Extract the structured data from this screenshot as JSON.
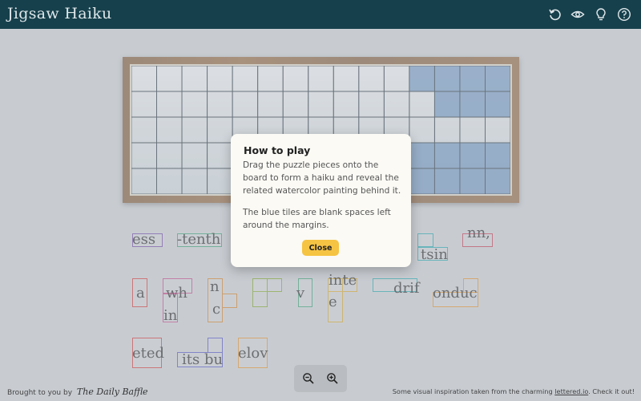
{
  "header": {
    "title": "Jigsaw Haiku",
    "icons": [
      "restart-icon",
      "eye-icon",
      "hint-bulb-icon",
      "help-icon"
    ]
  },
  "pieces": [
    {
      "text": "ess",
      "color": "#6b3fa0"
    },
    {
      "text": "-tenth",
      "color": "#2e9a6b"
    },
    {
      "text": "tsin",
      "color": "#1aa0a8"
    },
    {
      "text": "nn,",
      "color": "#c0344a"
    },
    {
      "text": "a",
      "color": "#d03030"
    },
    {
      "text": "wh",
      "color": "#c04080"
    },
    {
      "text": "in",
      "color": "#c04080"
    },
    {
      "text": "n",
      "color": "#d07a20"
    },
    {
      "text": "c",
      "color": "#d07a20"
    },
    {
      "text": "v",
      "color": "#2e9a6b"
    },
    {
      "text": "inte",
      "color": "#d4a020"
    },
    {
      "text": "e",
      "color": "#d4a020"
    },
    {
      "text": "drif",
      "color": "#1aa0a8"
    },
    {
      "text": "onduc",
      "color": "#e08a20"
    },
    {
      "text": "eted",
      "color": "#d03030"
    },
    {
      "text": "its bu",
      "color": "#4a4ac0"
    },
    {
      "text": "elov",
      "color": "#e08a20"
    }
  ],
  "modal": {
    "title": "How to play",
    "paragraph1": "Drag the puzzle pieces onto the board to form a haiku and reveal the related watercolor painting behind it.",
    "paragraph2": "The blue tiles are blank spaces left around the margins.",
    "close_label": "Close"
  },
  "zoom": {
    "out_icon": "zoom-out-icon",
    "in_icon": "zoom-in-icon"
  },
  "footer": {
    "left_prefix": "Brought to you by",
    "left_brand": "The Daily Baffle",
    "right_prefix": "Some visual inspiration taken from the charming",
    "right_link": "lettered.io",
    "right_suffix": ". Check it out!"
  },
  "colors": {
    "header_bg": "#16404c",
    "blank_tile": "#4f7fb5",
    "button": "#f6c443"
  }
}
